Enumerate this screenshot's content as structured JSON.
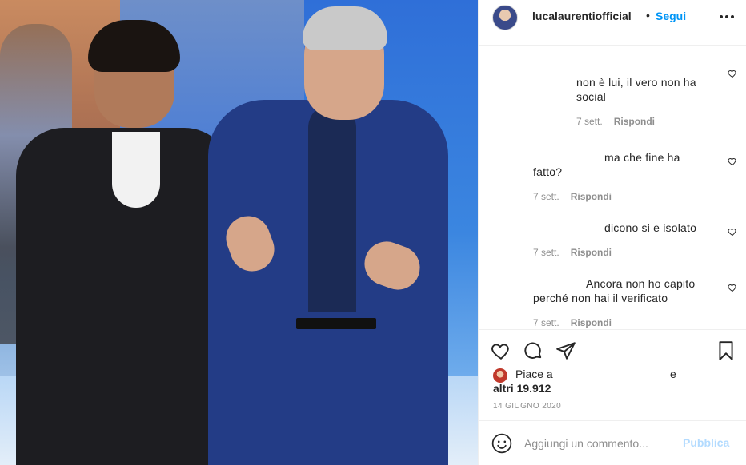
{
  "post": {
    "username": "lucalaurentiofficial",
    "separator": "•",
    "follow_label": "Segui",
    "more_icon": "more-options-icon"
  },
  "comments": [
    {
      "text_line1": "non è lui, il vero non ha",
      "text_line2": "social",
      "time": "7 sett.",
      "reply": "Rispondi"
    },
    {
      "text_line1": "ma che fine ha",
      "text_line2": "fatto?",
      "time": "7 sett.",
      "reply": "Rispondi"
    },
    {
      "text_line1": "dicono si e isolato",
      "text_line2": "",
      "time": "7 sett.",
      "reply": "Rispondi"
    },
    {
      "text_line1": "Ancora non ho capito",
      "text_line2": "perché non hai il verificato",
      "time": "7 sett.",
      "reply": "Rispondi"
    }
  ],
  "actions": {
    "likes_prefix": "Piace a",
    "likes_and": "e",
    "likes_others": "altri 19.912",
    "date": "14 GIUGNO 2020"
  },
  "add_comment": {
    "placeholder": "Aggiungi un commento...",
    "publish_label": "Pubblica"
  },
  "colors": {
    "accent": "#0095f6",
    "publish_disabled": "#b3dbff",
    "meta_text": "#8e8e8e"
  }
}
